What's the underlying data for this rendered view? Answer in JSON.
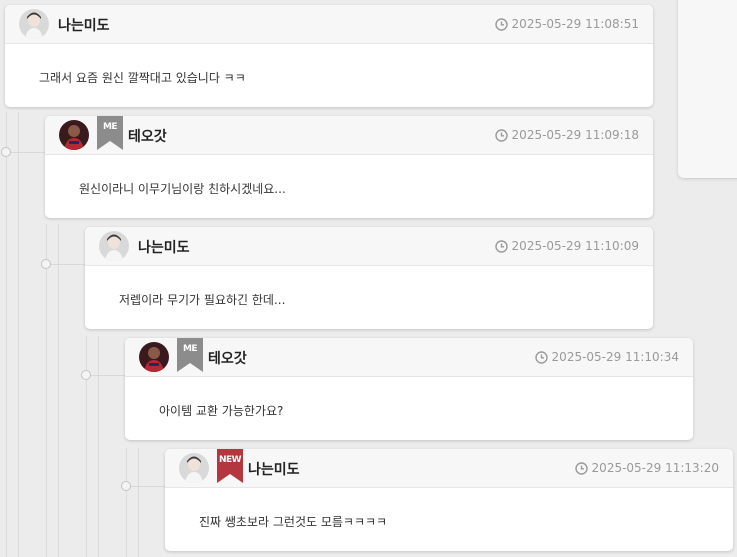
{
  "comments": [
    {
      "author": "나는미도",
      "avatar": "woman-avatar",
      "badge": null,
      "timestamp": "2025-05-29 11:08:51",
      "text": "그래서 요즘 원신 깔짝대고 있습니다 ㅋㅋ"
    },
    {
      "author": "테오갓",
      "avatar": "player-avatar",
      "badge": "ME",
      "timestamp": "2025-05-29 11:09:18",
      "text": "원신이라니 이무기님이랑 친하시겠네요..."
    },
    {
      "author": "나는미도",
      "avatar": "woman-avatar",
      "badge": null,
      "timestamp": "2025-05-29 11:10:09",
      "text": "저렙이라 무기가 필요하긴 한데..."
    },
    {
      "author": "테오갓",
      "avatar": "player-avatar",
      "badge": "ME",
      "timestamp": "2025-05-29 11:10:34",
      "text": "아이템 교환 가능한가요?"
    },
    {
      "author": "나는미도",
      "avatar": "woman-avatar",
      "badge": "NEW",
      "timestamp": "2025-05-29 11:13:20",
      "text": "진짜 쌩초보라 그런것도 모름ㅋㅋㅋㅋ"
    }
  ],
  "colors": {
    "me_badge": "#8c8c8c",
    "new_badge": "#b4373f",
    "timestamp": "#9a9a9a"
  },
  "icons": {
    "time": "clock-icon",
    "me_badge": "bookmark-icon",
    "new_badge": "bookmark-icon"
  }
}
